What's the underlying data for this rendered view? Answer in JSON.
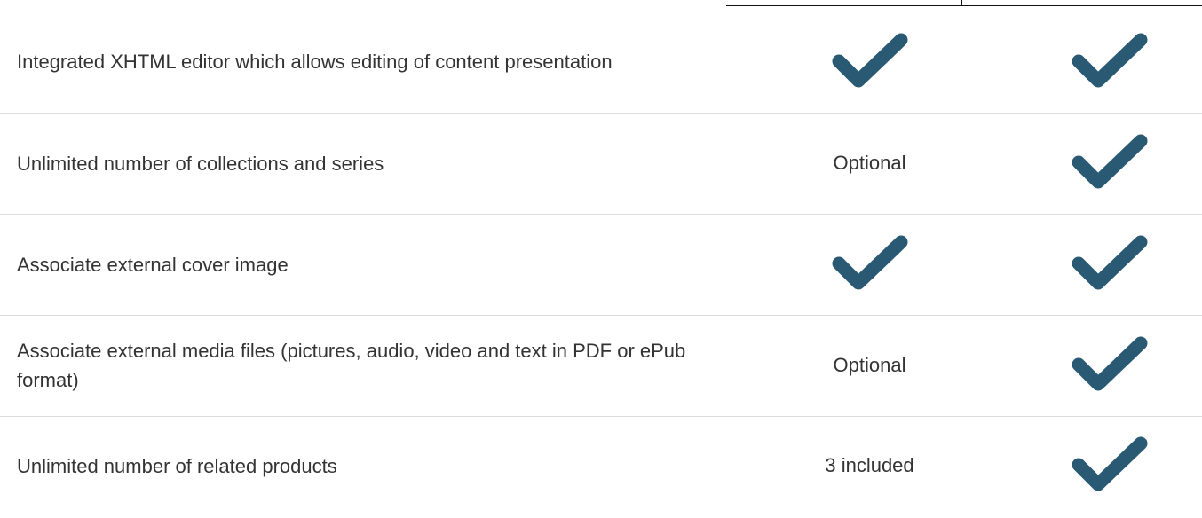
{
  "check_color": "#2a5a73",
  "rows": [
    {
      "feature": "Integrated XHTML editor which allows editing of content presentation",
      "basic": {
        "type": "check",
        "text": ""
      },
      "premium": {
        "type": "check",
        "text": ""
      }
    },
    {
      "feature": "Unlimited number of collections and series",
      "basic": {
        "type": "text",
        "text": "Optional"
      },
      "premium": {
        "type": "check",
        "text": ""
      }
    },
    {
      "feature": "Associate external cover image",
      "basic": {
        "type": "check",
        "text": ""
      },
      "premium": {
        "type": "check",
        "text": ""
      }
    },
    {
      "feature": "Associate external media files (pictures, audio, video and text in PDF or ePub format)",
      "basic": {
        "type": "text",
        "text": "Optional"
      },
      "premium": {
        "type": "check",
        "text": ""
      }
    },
    {
      "feature": "Unlimited number of related products",
      "basic": {
        "type": "text",
        "text": "3 included"
      },
      "premium": {
        "type": "check",
        "text": ""
      }
    }
  ]
}
